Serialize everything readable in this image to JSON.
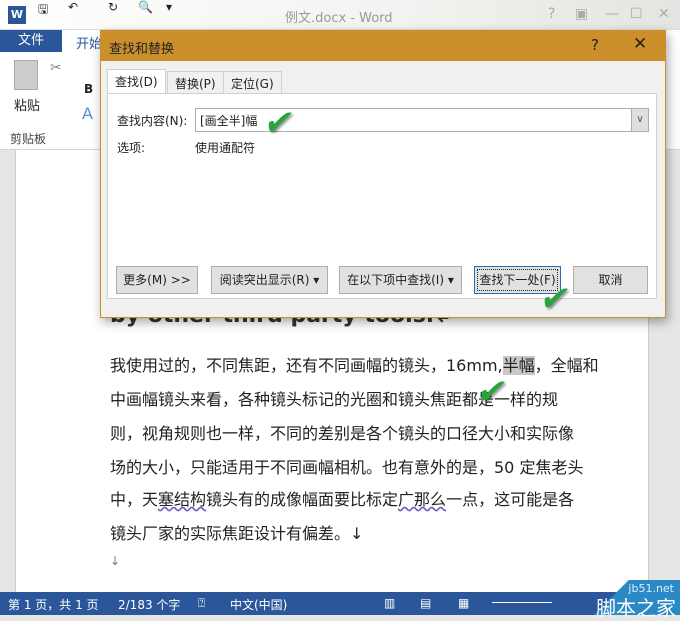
{
  "window": {
    "title": "例文.docx - Word",
    "help": "?",
    "restore": "▣",
    "minimize": "—",
    "maximize": "☐",
    "close": "✕"
  },
  "quick_access": {
    "word": "W",
    "save": "🖫",
    "undo": "↶",
    "redo": "↻",
    "preview": "🔍",
    "more": "▾"
  },
  "ribbon": {
    "file_tab": "文件",
    "home_tab": "开始",
    "paste": "粘贴",
    "clipboard": "剪贴板",
    "bold": "B",
    "font_color": "A"
  },
  "dialog": {
    "title": "查找和替换",
    "help": "?",
    "close": "✕",
    "tabs": [
      "查找(D)",
      "替换(P)",
      "定位(G)"
    ],
    "find_label": "查找内容(N):",
    "find_value": "[画全半]幅",
    "options_label": "选项:",
    "options_value": "使用通配符",
    "buttons": {
      "more": "更多(M) >>",
      "reading_highlight": "阅读突出显示(R) ▾",
      "find_in": "在以下项中查找(I) ▾",
      "find_next": "查找下一处(F)",
      "cancel": "取消"
    }
  },
  "document": {
    "partial_line": "by other third party tools.↲",
    "lines": [
      [
        "我使用过的，不同焦距，还有不同画幅的镜头，16mm,",
        "半幅",
        "，全幅和"
      ],
      "中画幅镜头来看，各种镜头标记的光圈和镜头焦距都是一样的规",
      "则，视角规则也一样，不同的差别是各个镜头的口径大小和实际像",
      "场的大小，只能适用于不同画幅相机。也有意外的是，50 定焦老头",
      [
        "中，天",
        "塞结构",
        "镜头有的成像幅面要比标定",
        "广那么",
        "一点，这可能是各"
      ],
      "镜头厂家的实际焦距设计有偏差。↓",
      "↓"
    ]
  },
  "status": {
    "page": "第 1 页，共 1 页",
    "words": "2/183 个字",
    "language": "中文(中国)"
  },
  "watermark": {
    "url": "jb51.net",
    "name": "脚本之家"
  },
  "colors": {
    "accent": "#2b579a",
    "dialog_title": "#cb8f2b",
    "check": "#2aa53c"
  }
}
